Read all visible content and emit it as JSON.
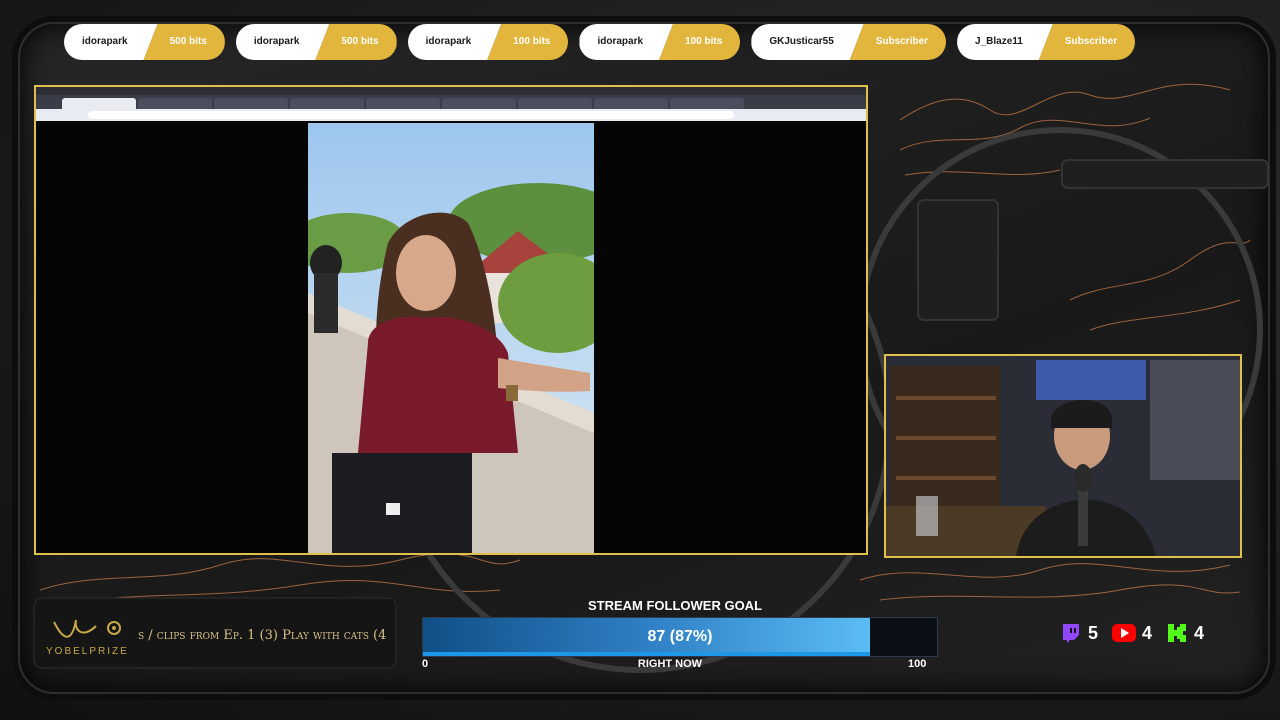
{
  "alerts": [
    {
      "name": "idorapark",
      "amount": "500 bits"
    },
    {
      "name": "idorapark",
      "amount": "500 bits"
    },
    {
      "name": "idorapark",
      "amount": "100 bits"
    },
    {
      "name": "idorapark",
      "amount": "100 bits"
    },
    {
      "name": "GKJusticar55",
      "amount": "Subscriber"
    },
    {
      "name": "J_Blaze11",
      "amount": "Subscriber"
    }
  ],
  "logo": {
    "text": "YOBELPRIZE"
  },
  "ticker": {
    "text": "s / clips from Ep. 1 (3) Play with cats (4"
  },
  "goal": {
    "title": "STREAM FOLLOWER GOAL",
    "value_label": "87 (87%)",
    "progress_fraction": 0.87,
    "min": "0",
    "center_label": "RIGHT NOW",
    "max": "100"
  },
  "socials": {
    "twitch": {
      "icon": "twitch-icon",
      "count": "5",
      "color": "#9146ff"
    },
    "youtube": {
      "icon": "youtube-icon",
      "count": "4",
      "color": "#ff0000"
    },
    "kick": {
      "icon": "kick-icon",
      "count": "4",
      "color": "#53fc18"
    }
  },
  "colors": {
    "accent_gold": "#e2b53c",
    "frame_gold": "#e0c04a"
  }
}
